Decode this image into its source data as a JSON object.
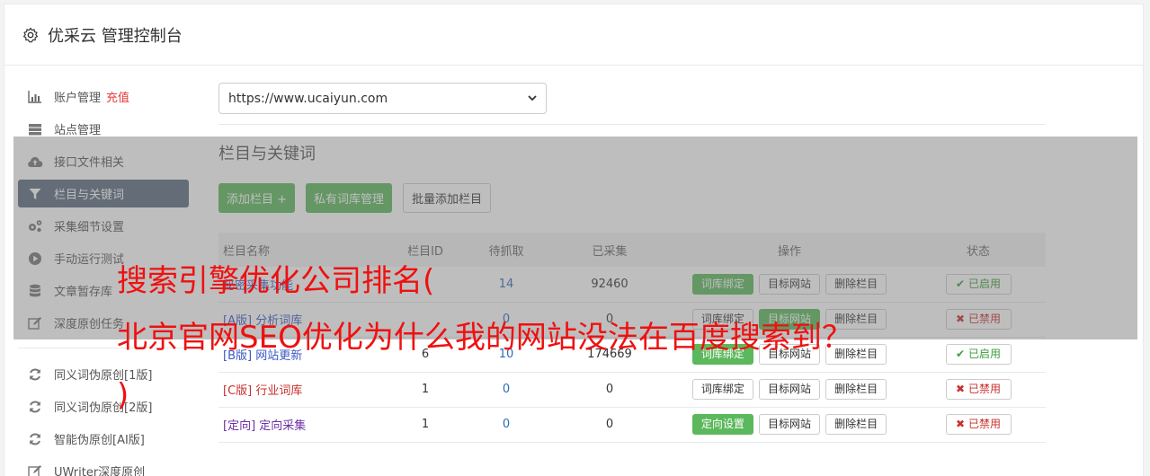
{
  "header": {
    "title": "优采云 管理控制台"
  },
  "sidebar": {
    "items": [
      {
        "label": "账户管理",
        "extra": "充值"
      },
      {
        "label": "站点管理"
      },
      {
        "label": "接口文件相关"
      },
      {
        "label": "栏目与关键词",
        "active": true
      },
      {
        "label": "采集细节设置"
      },
      {
        "label": "手动运行测试"
      },
      {
        "label": "文章暂存库"
      },
      {
        "label": "深度原创任务"
      }
    ],
    "items2": [
      {
        "label": "同义词伪原创[1版]"
      },
      {
        "label": "同义词伪原创[2版]"
      },
      {
        "label": "智能伪原创[AI版]"
      },
      {
        "label": "UWriter深度原创"
      }
    ]
  },
  "main": {
    "site_select": "https://www.ucaiyun.com",
    "section_title": "栏目与关键词",
    "buttons": {
      "add": "添加栏目 +",
      "private_lib": "私有词库管理",
      "batch_add": "批量添加栏目"
    },
    "table": {
      "headers": [
        "栏目名称",
        "栏目ID",
        "待抓取",
        "已采集",
        "操作",
        "状态"
      ],
      "rows": [
        {
          "tag": "",
          "name": "秘密采集功能",
          "id": "",
          "wait": "14",
          "collected": "92460",
          "op1": "词库绑定",
          "op2": "目标网站",
          "op3": "删除栏目",
          "status": "已启用",
          "on": true
        },
        {
          "tag": "[A版]",
          "name": "分析词库",
          "id": "",
          "wait": "0",
          "collected": "0",
          "op1": "词库绑定",
          "op2": "目标网站",
          "op3": "删除栏目",
          "status": "已禁用",
          "on": false
        },
        {
          "tag": "[B版]",
          "name": "网站更新",
          "id": "6",
          "wait": "10",
          "collected": "174669",
          "op1": "词库绑定",
          "op2": "目标网站",
          "op3": "删除栏目",
          "status": "已启用",
          "on": true
        },
        {
          "tag": "[C版]",
          "name": "行业词库",
          "id": "1",
          "wait": "0",
          "collected": "0",
          "op1": "词库绑定",
          "op2": "目标网站",
          "op3": "删除栏目",
          "status": "已禁用",
          "on": false
        },
        {
          "tag": "[定向]",
          "name": "定向采集",
          "id": "1",
          "wait": "0",
          "collected": "0",
          "op1": "定向设置",
          "op2": "目标网站",
          "op3": "删除栏目",
          "status": "已禁用",
          "on": false
        }
      ]
    }
  },
  "watermark": {
    "line1": "搜索引擎优化公司排名(",
    "line2": "北京官网SEO优化为什么我的网站没法在百度搜索到？",
    "line3": ")"
  },
  "colors": {
    "accent_green": "#5cb85c",
    "active_nav": "#5a6b7e",
    "watermark_red": "#f01010"
  }
}
